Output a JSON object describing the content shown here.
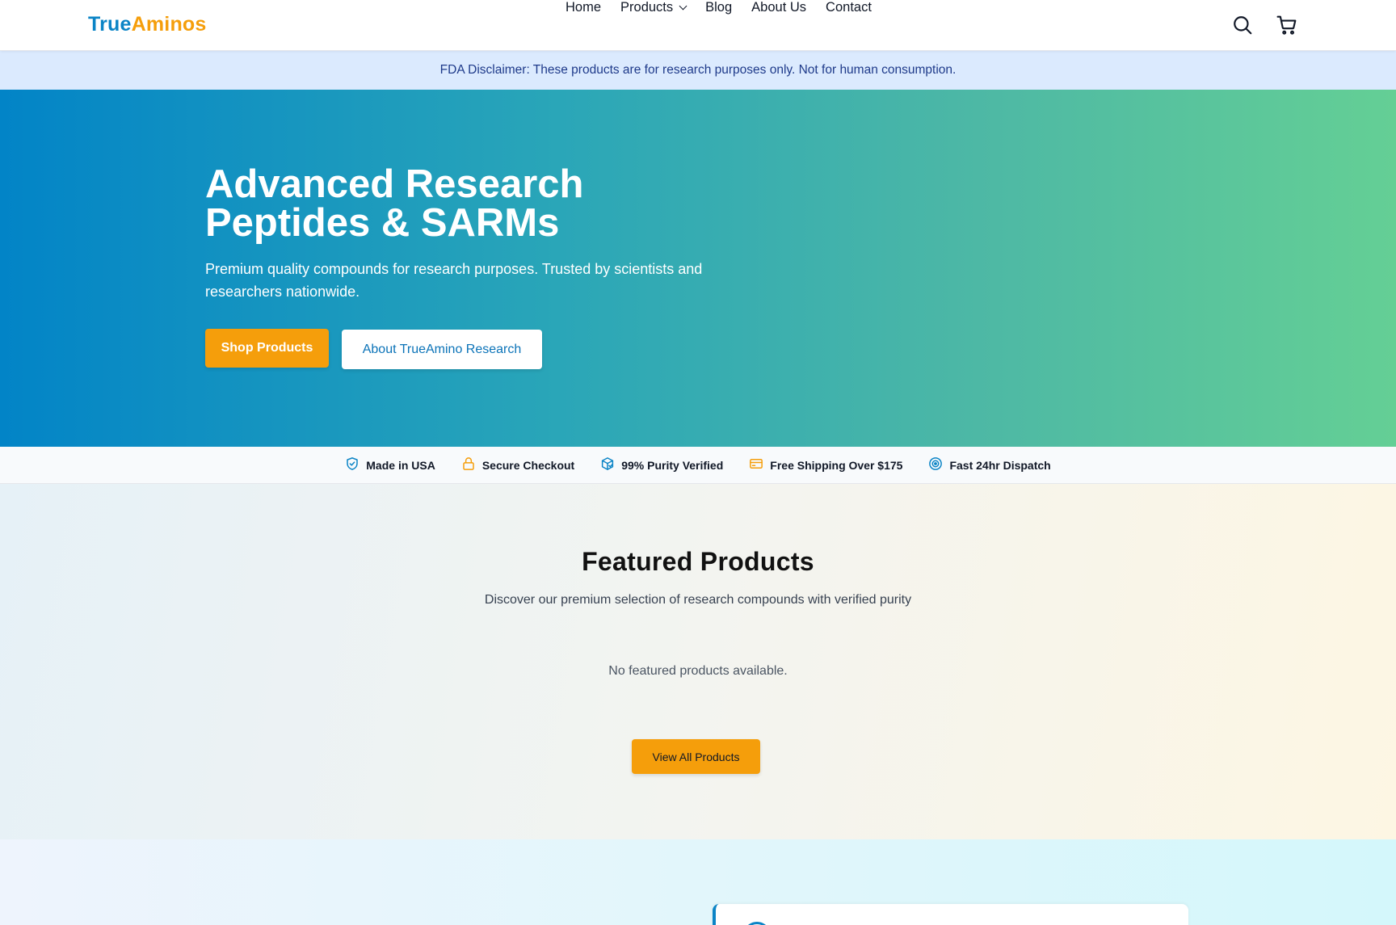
{
  "header": {
    "logo_part1": "True",
    "logo_part2": "Aminos",
    "nav": {
      "home": "Home",
      "products": "Products",
      "blog": "Blog",
      "about": "About Us",
      "contact": "Contact"
    },
    "icons": [
      "search-icon",
      "cart-icon",
      "chevron-down-icon"
    ]
  },
  "disclaimer": {
    "text": "FDA Disclaimer: These products are for research purposes only. Not for human consumption."
  },
  "hero": {
    "title_line1": "Advanced Research",
    "title_line2": "Peptides & SARMs",
    "subtitle": "Premium quality compounds for research purposes. Trusted by scientists and researchers nationwide.",
    "primary_button": "Shop Products",
    "secondary_button": "About TrueAmino Research"
  },
  "trust_bar": {
    "items": [
      {
        "label": "Made in USA",
        "icon": "shield-check-icon"
      },
      {
        "label": "Secure Checkout",
        "icon": "lock-icon"
      },
      {
        "label": "99% Purity Verified",
        "icon": "box-check-icon"
      },
      {
        "label": "Free Shipping Over $175",
        "icon": "credit-card-icon"
      },
      {
        "label": "Fast 24hr Dispatch",
        "icon": "target-icon"
      }
    ]
  },
  "featured": {
    "title": "Featured Products",
    "subtitle": "Discover our premium selection of research compounds with verified purity",
    "empty_message": "No featured products available.",
    "button": "View All Products"
  },
  "colors": {
    "brand_blue": "#0b84c6",
    "brand_orange": "#f59e0b",
    "disclaimer_bg": "#dbeafe",
    "hero_gradient_start": "#0284c7",
    "hero_gradient_end": "#64cf95"
  }
}
